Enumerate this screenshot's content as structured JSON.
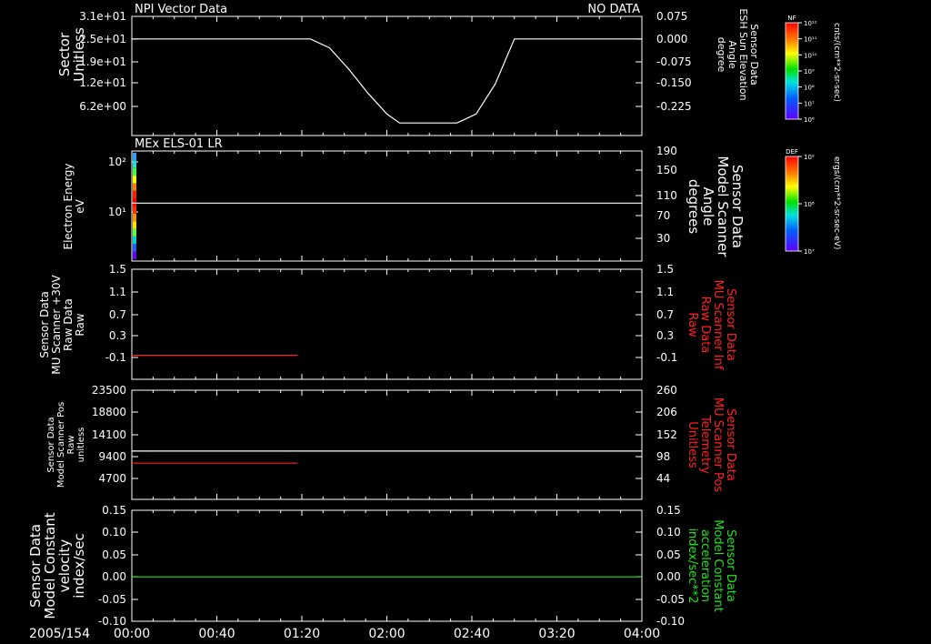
{
  "date_label": "2005/154",
  "time_ticks": [
    "00:00",
    "00:40",
    "01:20",
    "02:00",
    "02:40",
    "03:20",
    "04:00"
  ],
  "time_range_hours": [
    0,
    4
  ],
  "colors": {
    "background": "#000000",
    "axis": "#ffffff",
    "red": "#ff2020",
    "green": "#20e020"
  },
  "chart_data": [
    {
      "type": "line",
      "panel": "top",
      "title_left": "NPI Vector Data",
      "title_right": "NO DATA",
      "ylabel_left": [
        "Sector",
        "Unitless"
      ],
      "yticks_left": [
        "3.1e+01",
        "2.5e+01",
        "1.9e+01",
        "1.2e+01",
        "6.2e+00"
      ],
      "ylabel_right": [
        "Sensor Data",
        "ESH Sun Elevation",
        "Angle",
        "degree"
      ],
      "yticks_right": [
        "0.075",
        "0.000",
        "-0.075",
        "-0.150",
        "-0.225"
      ],
      "ylim_right": [
        -0.28,
        0.075
      ],
      "series": [
        {
          "axis": "right",
          "color": "#ffffff",
          "x": [
            0,
            0.25,
            0.5,
            0.75,
            1.0,
            1.2,
            1.4,
            1.55,
            1.7,
            1.85,
            2.0,
            2.1,
            2.25,
            2.4,
            2.55,
            2.7,
            2.85,
            3.0,
            3.25,
            3.5,
            3.75,
            4.0
          ],
          "y": [
            0.0,
            0.0,
            0.0,
            0.0,
            0.0,
            0.0,
            0.0,
            -0.03,
            -0.1,
            -0.18,
            -0.25,
            -0.28,
            -0.28,
            -0.28,
            -0.28,
            -0.25,
            -0.15,
            0.0,
            0.0,
            0.0,
            0.0,
            0.0
          ]
        }
      ],
      "colorbar": {
        "label": "NF",
        "unit": "cnts/(cm**2-sr-sec)",
        "ticks": [
          "10¹²",
          "10¹¹",
          "10¹⁰",
          "10⁹",
          "10⁸",
          "10⁷",
          "10⁶"
        ]
      }
    },
    {
      "type": "heatmap",
      "panel": "spectrogram",
      "title_left": "MEx ELS-01 LR",
      "ylabel_left": [
        "Electron Energy",
        "eV"
      ],
      "yticks_left": [
        "10²",
        "10¹"
      ],
      "ylabel_right": [
        "Sensor Data",
        "Model Scanner",
        "Angle",
        "degrees"
      ],
      "yticks_right": [
        "190",
        "150",
        "110",
        "70",
        "30"
      ],
      "ylim_right": [
        0,
        190
      ],
      "series": [
        {
          "axis": "right",
          "color": "#ffffff",
          "x": [
            0,
            4
          ],
          "y": [
            100,
            100
          ]
        }
      ],
      "colorbar": {
        "label": "DEF",
        "unit": "ergs/(cm**2-sr-sec-eV)",
        "ticks": [
          "10⁹",
          "10⁸",
          "10⁷"
        ]
      }
    },
    {
      "type": "line",
      "panel": "mu-raw",
      "ylabel_left": [
        "Sensor Data",
        "MU Scanner +30V",
        "Raw Data",
        "Raw"
      ],
      "yticks_left": [
        "1.5",
        "1.1",
        "0.7",
        "0.3",
        "-0.1"
      ],
      "ylabel_right": [
        "Sensor Data",
        "MU Scanner Inf",
        "Raw Data",
        "Raw"
      ],
      "yticks_right": [
        "1.5",
        "1.1",
        "0.7",
        "0.3",
        "-0.1"
      ],
      "ylim": [
        -0.45,
        1.5
      ],
      "series": [
        {
          "axis": "left",
          "color": "#ff2020",
          "x": [
            0,
            1.3
          ],
          "y": [
            -0.06,
            -0.06
          ]
        }
      ]
    },
    {
      "type": "line",
      "panel": "scanner-pos",
      "ylabel_left": [
        "Sensor Data",
        "Model Scanner Pos",
        "Raw",
        "unitless"
      ],
      "yticks_left": [
        "23500",
        "18800",
        "14100",
        "9400",
        "4700"
      ],
      "ylim_left": [
        0,
        23500
      ],
      "ylabel_right": [
        "Sensor Data",
        "MU Scanner Pos",
        "Telemetry",
        "Unitless"
      ],
      "yticks_right": [
        "260",
        "206",
        "152",
        "98",
        "44"
      ],
      "ylim_right": [
        0,
        260
      ],
      "series": [
        {
          "axis": "left",
          "color": "#ff2020",
          "x": [
            0,
            1.3
          ],
          "y": [
            7800,
            7800
          ]
        },
        {
          "axis": "right",
          "color": "#ffffff",
          "x": [
            0,
            4
          ],
          "y": [
            115,
            115
          ]
        }
      ]
    },
    {
      "type": "line",
      "panel": "velocity",
      "ylabel_left": [
        "Sensor Data",
        "Model Constant",
        "velocity",
        "index/sec"
      ],
      "yticks_left": [
        "0.15",
        "0.10",
        "0.05",
        "0.00",
        "-0.05",
        "-0.10"
      ],
      "ylim": [
        -0.1,
        0.15
      ],
      "ylabel_right": [
        "Sensor Data",
        "Model Constant",
        "acceleration",
        "index/sec**2"
      ],
      "yticks_right": [
        "0.15",
        "0.10",
        "0.05",
        "0.00",
        "-0.05",
        "-0.10"
      ],
      "series": [
        {
          "axis": "left",
          "color": "#20e020",
          "x": [
            0,
            4
          ],
          "y": [
            0,
            0
          ]
        }
      ]
    }
  ]
}
